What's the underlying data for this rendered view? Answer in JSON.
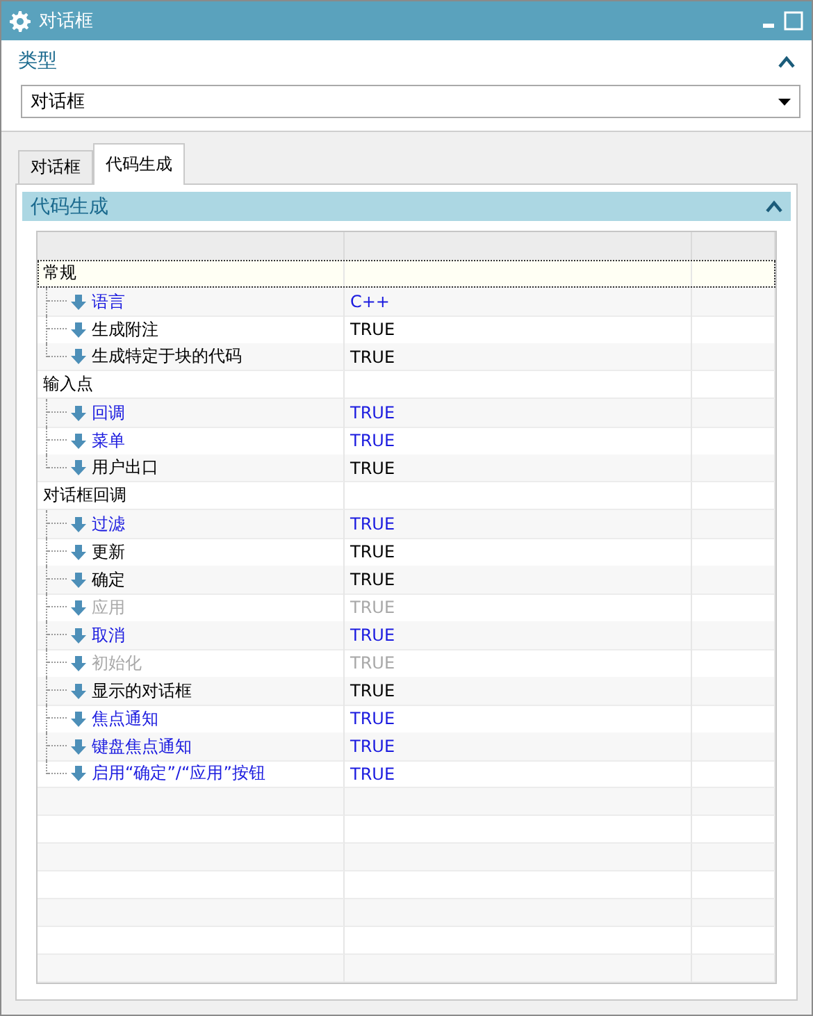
{
  "window": {
    "title": "对话框"
  },
  "type_section": {
    "title": "类型",
    "expanded": true,
    "dropdown": {
      "value": "对话框"
    }
  },
  "tabs": [
    {
      "label": "对话框",
      "selected": false
    },
    {
      "label": "代码生成",
      "selected": true
    }
  ],
  "code_panel": {
    "title": "代码生成",
    "expanded": true,
    "groups": [
      {
        "label": "常规",
        "focused": true,
        "children": [
          {
            "label": "语言",
            "value": "C++",
            "kind": "changed"
          },
          {
            "label": "生成附注",
            "value": "TRUE",
            "kind": "default"
          },
          {
            "label": "生成特定于块的代码",
            "value": "TRUE",
            "kind": "default"
          }
        ]
      },
      {
        "label": "输入点",
        "focused": false,
        "children": [
          {
            "label": "回调",
            "value": "TRUE",
            "kind": "changed"
          },
          {
            "label": "菜单",
            "value": "TRUE",
            "kind": "changed"
          },
          {
            "label": "用户出口",
            "value": "TRUE",
            "kind": "default"
          }
        ]
      },
      {
        "label": "对话框回调",
        "focused": false,
        "children": [
          {
            "label": "过滤",
            "value": "TRUE",
            "kind": "changed"
          },
          {
            "label": "更新",
            "value": "TRUE",
            "kind": "default"
          },
          {
            "label": "确定",
            "value": "TRUE",
            "kind": "default"
          },
          {
            "label": "应用",
            "value": "TRUE",
            "kind": "disabled"
          },
          {
            "label": "取消",
            "value": "TRUE",
            "kind": "changed"
          },
          {
            "label": "初始化",
            "value": "TRUE",
            "kind": "disabled"
          },
          {
            "label": "显示的对话框",
            "value": "TRUE",
            "kind": "default"
          },
          {
            "label": "焦点通知",
            "value": "TRUE",
            "kind": "changed"
          },
          {
            "label": "键盘焦点通知",
            "value": "TRUE",
            "kind": "changed"
          },
          {
            "label": "启用“确定”/“应用”按钮",
            "value": "TRUE",
            "kind": "changed"
          }
        ]
      }
    ]
  }
}
